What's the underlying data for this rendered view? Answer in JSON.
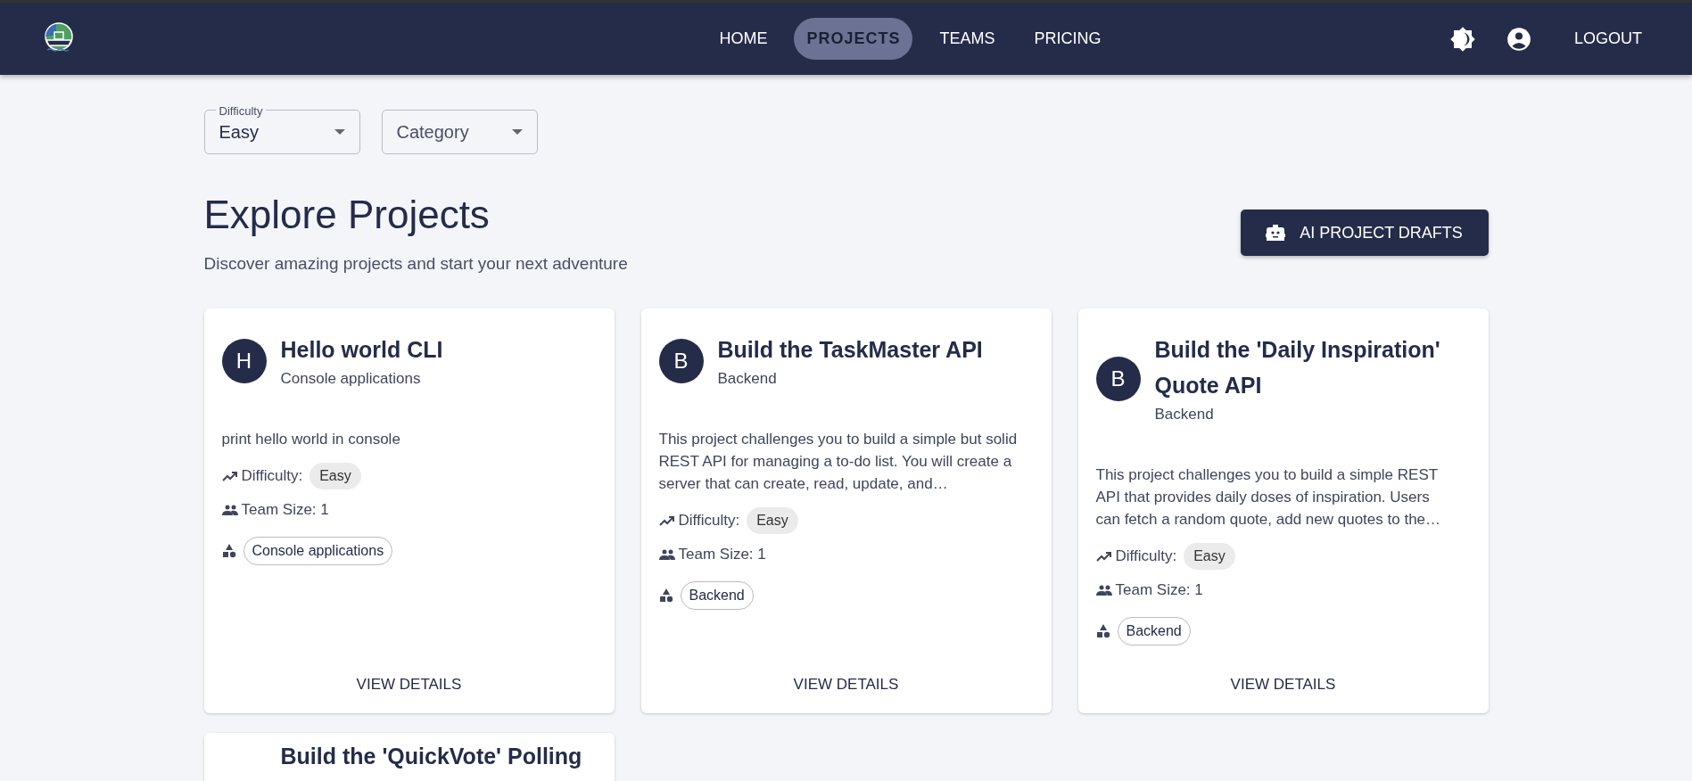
{
  "navbar": {
    "links": [
      {
        "label": "HOME",
        "selected": false
      },
      {
        "label": "PROJECTS",
        "selected": true
      },
      {
        "label": "TEAMS",
        "selected": false
      },
      {
        "label": "PRICING",
        "selected": false
      }
    ],
    "logout": "LOGOUT"
  },
  "filters": [
    {
      "label": "Difficulty",
      "value": "Easy"
    },
    {
      "label": "Category"
    }
  ],
  "header": {
    "title": "Explore Projects",
    "subtitle": "Discover amazing projects and start your next adventure",
    "button": "AI PROJECT DRAFTS"
  },
  "projects": [
    {
      "initial": "H",
      "title": "Hello world CLI",
      "category": "Console applications",
      "description": "print hello world in console",
      "difficulty_label": "Difficulty:",
      "difficulty": "Easy",
      "team_size": "Team Size: 1",
      "tag": "Console applications",
      "action": "VIEW DETAILS"
    },
    {
      "initial": "B",
      "title": "Build the TaskMaster API",
      "category": "Backend",
      "description": "This project challenges you to build a simple but solid REST API for managing a to-do list. You will create a server that can create, read, update, and…",
      "difficulty_label": "Difficulty:",
      "difficulty": "Easy",
      "team_size": "Team Size: 1",
      "tag": "Backend",
      "action": "VIEW DETAILS"
    },
    {
      "initial": "B",
      "title": "Build the 'Daily Inspiration' Quote API",
      "category": "Backend",
      "description": "This project challenges you to build a simple REST API that provides daily doses of inspiration. Users can fetch a random quote, add new quotes to the…",
      "difficulty_label": "Difficulty:",
      "difficulty": "Easy",
      "team_size": "Team Size: 1",
      "tag": "Backend",
      "action": "VIEW DETAILS"
    },
    {
      "title": "Build the 'QuickVote' Polling"
    }
  ]
}
